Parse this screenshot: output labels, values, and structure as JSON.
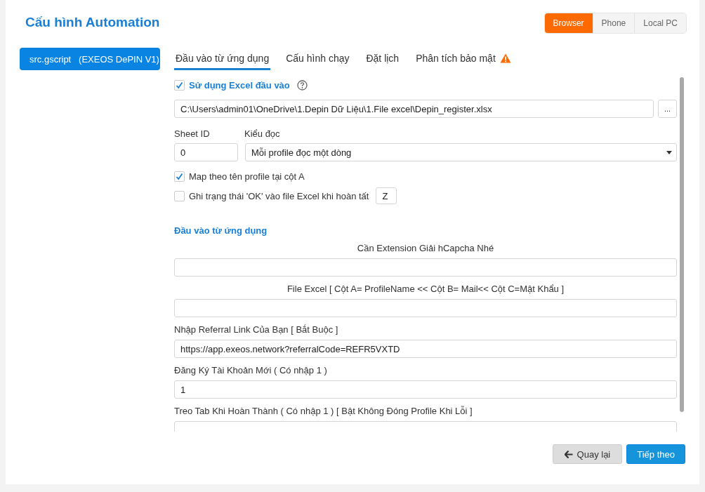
{
  "title": "Cấu hình Automation",
  "platforms": [
    {
      "label": "Browser",
      "selected": true
    },
    {
      "label": "Phone",
      "selected": false
    },
    {
      "label": "Local PC",
      "selected": false
    }
  ],
  "scripts": [
    {
      "label": "src.gscript   (EXEOS DePIN V1)",
      "selected": true
    }
  ],
  "tabs": [
    {
      "label": "Đầu vào từ ứng dụng",
      "selected": true,
      "warning": false
    },
    {
      "label": "Cấu hình chạy",
      "selected": false,
      "warning": false
    },
    {
      "label": "Đặt lịch",
      "selected": false,
      "warning": false
    },
    {
      "label": "Phân tích bảo mật",
      "selected": false,
      "warning": true
    }
  ],
  "excel": {
    "label": "Sử dụng Excel đầu vào",
    "checked": true,
    "path": "C:\\Users\\admin01\\OneDrive\\1.Depin Dữ Liệu\\1.File excel\\Depin_register.xlsx",
    "browse_button": "...",
    "sheet_id_label": "Sheet ID",
    "sheet_id": "0",
    "read_mode_label": "Kiểu đọc",
    "read_mode": "Mỗi profile đọc một dòng",
    "options": [
      {
        "label": "Map theo tên profile tại cột A",
        "checked": true
      },
      {
        "label": "Ghi trạng thái 'OK' vào file Excel khi hoàn tất",
        "checked": false,
        "column": "Z"
      }
    ]
  },
  "section_title": "Đầu vào từ ứng dụng",
  "inputs": [
    {
      "kind": "centered",
      "label": "Cần Extension Giải hCapcha Nhé"
    },
    {
      "kind": "centered",
      "label": "File Excel [ Cột A= ProfileName << Cột B= Mail<< Cột C=Mật Khẩu ]"
    },
    {
      "kind": "plain",
      "label": "Nhập Referral Link Của Bạn [ Bắt Buộc ]",
      "value": "https://app.exeos.network?referralCode=REFR5VXTD"
    },
    {
      "kind": "plain",
      "label": "Đăng Ký Tài Khoản Mới ( Có nhập 1 )",
      "value": "1"
    },
    {
      "kind": "plain",
      "label": "Treo Tab Khi Hoàn Thành ( Có nhập 1 ) [ Bật Không Đóng Profile Khi Lỗi ]"
    }
  ],
  "back_button": "Quay lại",
  "next_button": "Tiếp theo"
}
